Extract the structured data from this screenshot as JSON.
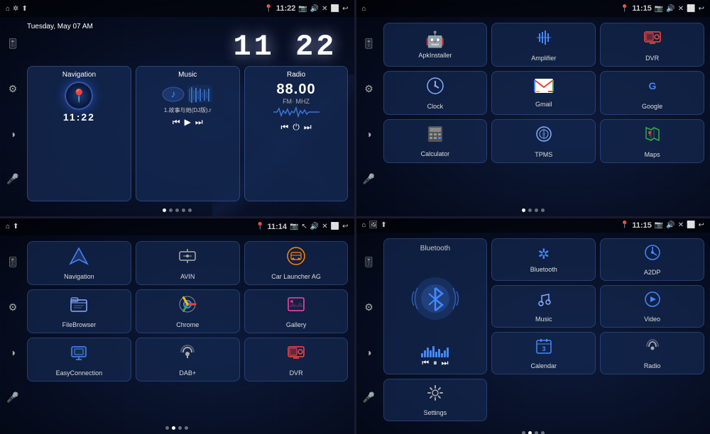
{
  "quadrants": [
    {
      "id": "q1",
      "status_bar": {
        "left_icons": [
          "home",
          "bluetooth",
          "usb"
        ],
        "time": "11:22",
        "right_icons": [
          "camera",
          "volume",
          "X",
          "window",
          "back"
        ]
      },
      "datetime_label": "Tuesday, May 07  AM",
      "clock_display": "11 22",
      "widgets": [
        {
          "id": "nav-widget",
          "title": "Navigation",
          "type": "navigation",
          "sub_time": "11:22"
        },
        {
          "id": "music-widget",
          "title": "Music",
          "type": "music",
          "track": "1.故事与她(DJ版).r"
        },
        {
          "id": "radio-widget",
          "title": "Radio",
          "type": "radio",
          "frequency": "88.00",
          "band": "FM·  MHZ"
        }
      ],
      "dots": [
        true,
        false,
        false,
        false,
        false
      ]
    },
    {
      "id": "q2",
      "status_bar": {
        "left_icons": [
          "home"
        ],
        "time": "11:15",
        "right_icons": [
          "camera",
          "volume",
          "X",
          "window",
          "back"
        ]
      },
      "apps": [
        {
          "id": "apk-installer",
          "label": "ApkInstaller",
          "icon": "android"
        },
        {
          "id": "amplifier",
          "label": "Amplifier",
          "icon": "amplifier"
        },
        {
          "id": "dvr",
          "label": "DVR",
          "icon": "dvr"
        },
        {
          "id": "clock",
          "label": "Clock",
          "icon": "clock"
        },
        {
          "id": "gmail",
          "label": "Gmail",
          "icon": "gmail"
        },
        {
          "id": "google",
          "label": "Google",
          "icon": "google"
        },
        {
          "id": "calculator",
          "label": "Calculator",
          "icon": "calculator"
        },
        {
          "id": "tpms",
          "label": "TPMS",
          "icon": "tpms"
        },
        {
          "id": "maps",
          "label": "Maps",
          "icon": "maps"
        }
      ],
      "dots": [
        true,
        false,
        false,
        false
      ]
    },
    {
      "id": "q3",
      "status_bar": {
        "left_icons": [
          "home",
          "bluetooth"
        ],
        "time": "11:14",
        "right_icons": [
          "camera",
          "volume",
          "X",
          "window",
          "back"
        ]
      },
      "apps": [
        {
          "id": "navigation",
          "label": "Navigation",
          "icon": "nav"
        },
        {
          "id": "avin",
          "label": "AVIN",
          "icon": "avin"
        },
        {
          "id": "car-launcher",
          "label": "Car Launcher AG",
          "icon": "carlaunch"
        },
        {
          "id": "file-browser",
          "label": "FileBrowser",
          "icon": "filebrowser"
        },
        {
          "id": "chrome",
          "label": "Chrome",
          "icon": "chrome"
        },
        {
          "id": "gallery",
          "label": "Gallery",
          "icon": "gallery"
        },
        {
          "id": "easy-connection",
          "label": "EasyConnection",
          "icon": "easyconn"
        },
        {
          "id": "dab-plus",
          "label": "DAB+",
          "icon": "dabplus"
        },
        {
          "id": "dvr2",
          "label": "DVR",
          "icon": "dvr"
        }
      ],
      "dots": [
        false,
        true,
        false,
        false
      ]
    },
    {
      "id": "q4",
      "status_bar": {
        "left_icons": [
          "home",
          "bluetooth"
        ],
        "time": "11:15",
        "right_icons": [
          "camera",
          "volume",
          "X",
          "window",
          "back"
        ]
      },
      "bluetooth_widget": {
        "label": "Bluetooth",
        "controls": [
          "prev",
          "play",
          "next"
        ]
      },
      "apps": [
        {
          "id": "bluetooth-app",
          "label": "Bluetooth",
          "icon": "bluetooth"
        },
        {
          "id": "a2dp",
          "label": "A2DP",
          "icon": "a2dp"
        },
        {
          "id": "music-app",
          "label": "Music",
          "icon": "music"
        },
        {
          "id": "video",
          "label": "Video",
          "icon": "video"
        },
        {
          "id": "calendar",
          "label": "Calendar",
          "icon": "calendar"
        },
        {
          "id": "radio-app",
          "label": "Radio",
          "icon": "radio"
        },
        {
          "id": "settings",
          "label": "Settings",
          "icon": "settings"
        }
      ],
      "dots": [
        false,
        true,
        false,
        false
      ]
    }
  ],
  "icons": {
    "home": "⌂",
    "bluetooth": "₿",
    "usb": "⚡",
    "camera": "📷",
    "volume": "🔊",
    "back": "↩",
    "settings_icon": "⚙",
    "contrast": "◑",
    "mic": "🎤",
    "equalizer": "🎚",
    "pin": "📍",
    "music_note": "🎵",
    "prev": "⏮",
    "play": "▶",
    "next": "⏭",
    "pause": "⏸",
    "power": "⏻"
  }
}
